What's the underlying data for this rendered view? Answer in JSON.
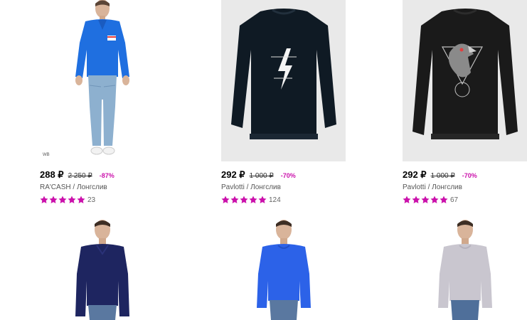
{
  "accent_color": "#cb11ab",
  "products": [
    {
      "price": "288 ₽",
      "old_price": "2 250 ₽",
      "discount": "-87%",
      "brand": "RA'CASH",
      "category": "Лонгслив",
      "stars": 5,
      "reviews": "23",
      "wb_mark": "WB"
    },
    {
      "price": "292 ₽",
      "old_price": "1 000 ₽",
      "discount": "-70%",
      "brand": "Pavlotti",
      "category": "Лонгслив",
      "stars": 5,
      "reviews": "124"
    },
    {
      "price": "292 ₽",
      "old_price": "1 000 ₽",
      "discount": "-70%",
      "brand": "Pavlotti",
      "category": "Лонгслив",
      "stars": 5,
      "reviews": "67"
    }
  ],
  "bottom_products": [
    {
      "color": "navy",
      "icon": "navy-longsleeve-model"
    },
    {
      "color": "blue",
      "icon": "blue-longsleeve-model"
    },
    {
      "color": "light-gray",
      "icon": "gray-longsleeve-model"
    }
  ]
}
